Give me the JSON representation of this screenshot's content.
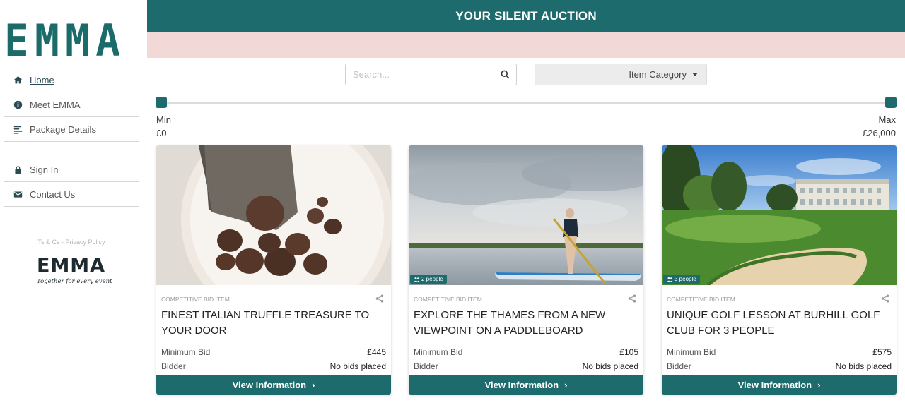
{
  "brand": {
    "logo": "EMMA",
    "logo_small": "EMMA",
    "tagline": "Together for every event"
  },
  "sidebar": {
    "items": [
      {
        "label": "Home",
        "icon": "home-icon"
      },
      {
        "label": "Meet EMMA",
        "icon": "info-icon"
      },
      {
        "label": "Package Details",
        "icon": "list-icon"
      },
      {
        "label": "Sign In",
        "icon": "lock-icon"
      },
      {
        "label": "Contact Us",
        "icon": "envelope-icon"
      }
    ],
    "legal": "Ts & Cs - Privacy Policy"
  },
  "header": {
    "title": "YOUR SILENT AUCTION"
  },
  "filters": {
    "search_placeholder": "Search...",
    "category_label": "Item Category",
    "range": {
      "min_label": "Min",
      "max_label": "Max",
      "min_value": "£0",
      "max_value": "£26,000"
    }
  },
  "colors": {
    "primary": "#1d6b6c",
    "pink": "#f3d8d8"
  },
  "cards": [
    {
      "type": "COMPETITIVE BID ITEM",
      "title": "FINEST ITALIAN TRUFFLE TREASURE TO YOUR DOOR",
      "people": "",
      "min_bid_label": "Minimum Bid",
      "min_bid": "£445",
      "bidder_label": "Bidder",
      "bidder": "No bids placed",
      "button": "View Information"
    },
    {
      "type": "COMPETITIVE BID ITEM",
      "title": "EXPLORE THE THAMES FROM A NEW VIEWPOINT ON A PADDLEBOARD",
      "people": "2 people",
      "min_bid_label": "Minimum Bid",
      "min_bid": "£105",
      "bidder_label": "Bidder",
      "bidder": "No bids placed",
      "button": "View Information"
    },
    {
      "type": "COMPETITIVE BID ITEM",
      "title": "UNIQUE GOLF LESSON AT BURHILL GOLF CLUB FOR 3 PEOPLE",
      "people": "3 people",
      "min_bid_label": "Minimum Bid",
      "min_bid": "£575",
      "bidder_label": "Bidder",
      "bidder": "No bids placed",
      "button": "View Information"
    }
  ]
}
